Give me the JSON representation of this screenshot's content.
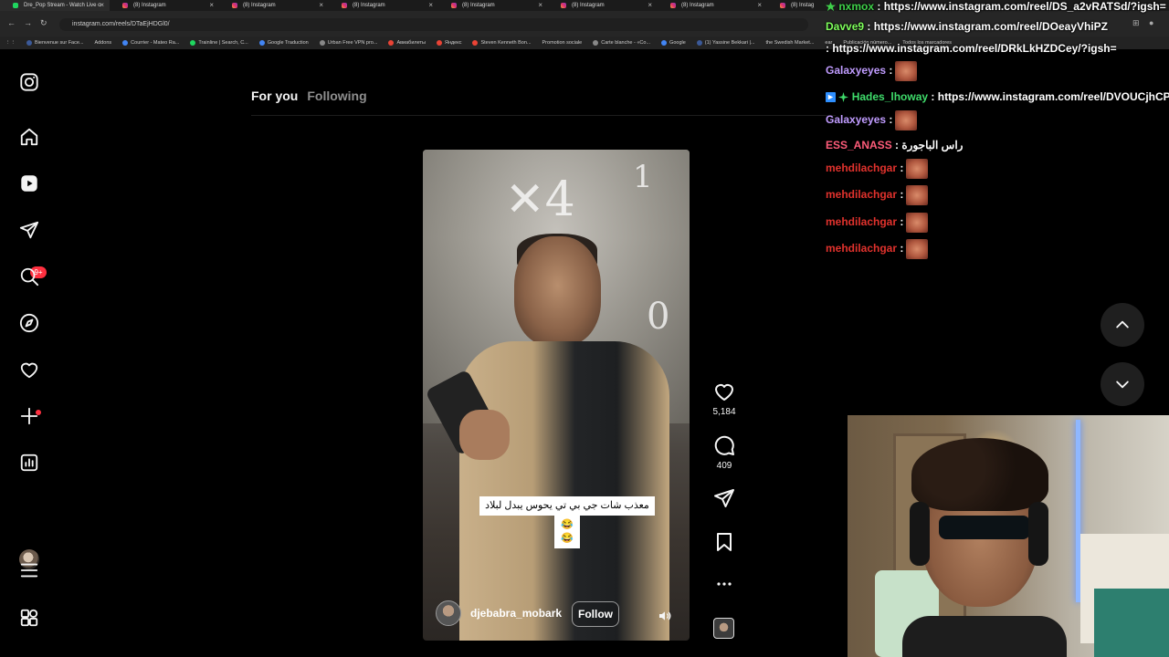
{
  "browser": {
    "tabs": [
      {
        "title": "Dre_Pop Stream - Watch Live o",
        "type": "stream"
      },
      {
        "title": "(8) Instagram",
        "type": "instagram"
      },
      {
        "title": "(8) Instagram",
        "type": "instagram"
      },
      {
        "title": "(8) Instagram",
        "type": "instagram"
      },
      {
        "title": "(8) Instagram",
        "type": "instagram"
      },
      {
        "title": "(8) Instagram",
        "type": "instagram"
      },
      {
        "title": "(8) Instagram",
        "type": "instagram"
      },
      {
        "title": "(8) Instag",
        "type": "instagram"
      }
    ],
    "url": "instagram.com/reels/DTaEjHDGl0/",
    "bookmarks": [
      "Bienvenue sur Face...",
      "Addons",
      "Courrier - Mateo Ra...",
      "Trainline | Search, C...",
      "Google Traduction",
      "Urban Free VPN pro...",
      "Авиабилеты",
      "Яндекс",
      "Steven Kenneth Bon...",
      "Promotion sociale",
      "Carte blanche - «Co...",
      "Google",
      "(1) Yassine Bekkari |...",
      "the Swedish Market...",
      "ear",
      "Publicación número...",
      "Todos los marcadores"
    ]
  },
  "sidebar": {
    "items": [
      {
        "name": "instagram-logo-icon"
      },
      {
        "name": "home-icon"
      },
      {
        "name": "reels-icon"
      },
      {
        "name": "messages-icon",
        "badge": "9+"
      },
      {
        "name": "search-icon"
      },
      {
        "name": "explore-icon"
      },
      {
        "name": "notifications-icon"
      },
      {
        "name": "create-icon"
      },
      {
        "name": "dashboard-icon"
      },
      {
        "name": "profile-avatar"
      },
      {
        "name": "more-menu-icon"
      },
      {
        "name": "also-from-meta-icon"
      }
    ]
  },
  "feed": {
    "tabs": [
      "For you",
      "Following"
    ],
    "active_tab": "For you"
  },
  "reel": {
    "caption_line1": "معذب شات جي بي تي يحوس يبدل لبلاد",
    "caption_line2": "😂😂",
    "author": "djebabra_mobark",
    "follow_label": "Follow",
    "likes": "5,184",
    "comments": "409"
  },
  "chat": {
    "messages": [
      {
        "user": "nxmox",
        "text": "https://www.instagram.com/reel/DS_a2vRATSd/?igsh=",
        "color": "#3fd14a"
      },
      {
        "user": "Davve9",
        "text": "https://www.instagram.com/reel/DOeayVhiPZ",
        "color": "#7fff5c"
      },
      {
        "user": "",
        "text": "https://www.instagram.com/reel/DRkLkHZDCey/?igsh=",
        "color": "#c43a3a"
      },
      {
        "user": "Galaxyeyes",
        "text": "",
        "emote": true,
        "color": "#c09cff"
      },
      {
        "user": "Hades_lhoway",
        "text": "https://www.instagram.com/reel/DVOUCjhCP",
        "color": "#3fdc6b"
      },
      {
        "user": "Galaxyeyes",
        "text": "",
        "emote": true,
        "color": "#c09cff"
      },
      {
        "user": "ESS_ANASS",
        "text": "راس الباجورة",
        "color": "#ff5c7a"
      },
      {
        "user": "mehdilachgar",
        "text": "",
        "emote": true,
        "color": "#e1322d"
      },
      {
        "user": "mehdilachgar",
        "text": "",
        "emote": true,
        "color": "#e1322d"
      },
      {
        "user": "mehdilachgar",
        "text": "",
        "emote": true,
        "color": "#e1322d"
      },
      {
        "user": "mehdilachgar",
        "text": "",
        "emote": true,
        "color": "#e1322d"
      }
    ]
  },
  "colors": {
    "background": "#000000",
    "accent_red": "#ff3040",
    "muted_text": "#8e8e8e"
  }
}
